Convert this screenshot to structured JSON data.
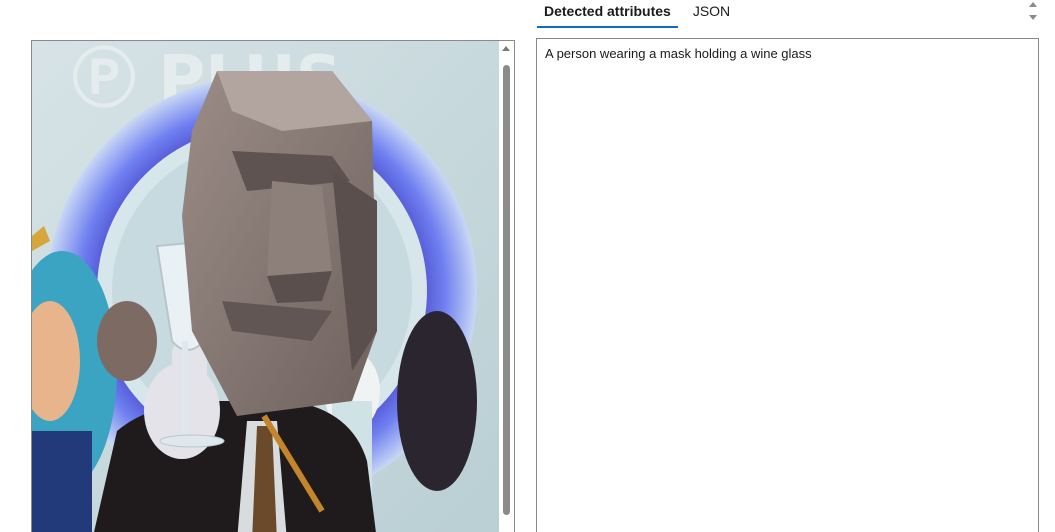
{
  "tabs": [
    {
      "label": "Detected attributes",
      "active": true
    },
    {
      "label": "JSON",
      "active": false
    }
  ],
  "results": {
    "caption": "A person wearing a mask holding a wine glass"
  },
  "image": {
    "description_icon": "photo-image"
  },
  "colors": {
    "tab_accent": "#0f6cbd",
    "border": "#8a8a8a"
  }
}
